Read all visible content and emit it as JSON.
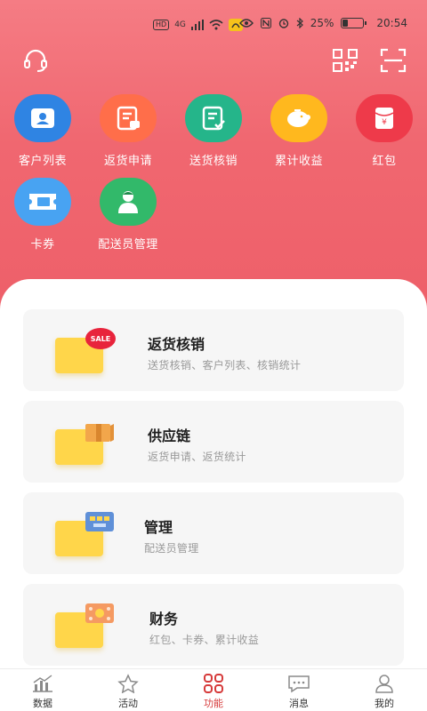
{
  "status_bar": {
    "hd": "HD",
    "network": "4G",
    "battery": "25%",
    "time": "20:54",
    "battery_level": 0.25
  },
  "header": {
    "support_icon": "headset-icon",
    "qr_icon": "qr-code-icon",
    "scan_icon": "scan-icon"
  },
  "quick_actions": [
    {
      "label": "客户列表",
      "icon": "customer-card-icon",
      "color": "#2f84e3"
    },
    {
      "label": "返货申请",
      "icon": "return-doc-icon",
      "color": "#ff6e4a"
    },
    {
      "label": "送货核销",
      "icon": "delivery-check-icon",
      "color": "#25b58a"
    },
    {
      "label": "累计收益",
      "icon": "piggy-bank-icon",
      "color": "#ffb81e"
    },
    {
      "label": "红包",
      "icon": "red-envelope-icon",
      "color": "#ee3a4a"
    },
    {
      "label": "卡券",
      "icon": "coupon-icon",
      "color": "#48a3f2"
    },
    {
      "label": "配送员管理",
      "icon": "courier-icon",
      "color": "#32b96a"
    }
  ],
  "cards": [
    {
      "title": "返货核销",
      "subtitle": "送货核销、客户列表、核销统计",
      "badge": "SALE"
    },
    {
      "title": "供应链",
      "subtitle": "返货申请、返货统计"
    },
    {
      "title": "管理",
      "subtitle": "配送员管理"
    },
    {
      "title": "财务",
      "subtitle": "红包、卡券、累计收益"
    }
  ],
  "tabs": [
    {
      "label": "数据",
      "icon": "chart-icon"
    },
    {
      "label": "活动",
      "icon": "star-icon"
    },
    {
      "label": "功能",
      "icon": "grid-icon",
      "active": true
    },
    {
      "label": "消息",
      "icon": "chat-icon"
    },
    {
      "label": "我的",
      "icon": "profile-icon"
    }
  ],
  "accent": "#d63a3a"
}
